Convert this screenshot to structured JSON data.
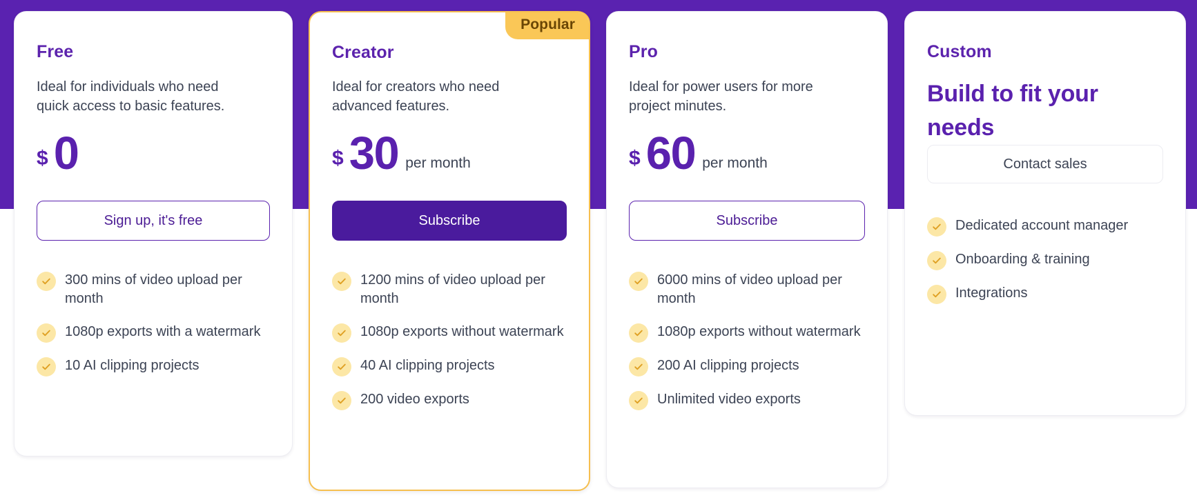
{
  "page": {
    "background_band_color": "#5a22b0",
    "page_background": "#ffffff"
  },
  "colors": {
    "brand_purple": "#5a21ae",
    "brand_purple_dark": "#4a1b9d",
    "accent_amber": "#fac757",
    "check_circle": "#fce7a6",
    "check_mark": "#dfa023",
    "body_text": "#3c4354"
  },
  "plans": [
    {
      "id": "free",
      "name": "Free",
      "description": "Ideal for individuals who need quick access to basic features.",
      "currency": "$",
      "amount": "0",
      "period": "",
      "cta_label": "Sign up, it's free",
      "cta_style": "outline-purple",
      "badge": null,
      "headline": null,
      "features": [
        "300 mins of video upload per month",
        "1080p exports with a watermark",
        "10 AI clipping projects"
      ]
    },
    {
      "id": "creator",
      "name": "Creator",
      "description": "Ideal for creators who need advanced features.",
      "currency": "$",
      "amount": "30",
      "period": "per month",
      "cta_label": "Subscribe",
      "cta_style": "solid-purple",
      "badge": "Popular",
      "headline": null,
      "features": [
        "1200 mins of video upload per month",
        "1080p exports without watermark",
        "40 AI clipping projects",
        "200 video exports"
      ]
    },
    {
      "id": "pro",
      "name": "Pro",
      "description": "Ideal for power users for more project minutes.",
      "currency": "$",
      "amount": "60",
      "period": "per month",
      "cta_label": "Subscribe",
      "cta_style": "outline-purple",
      "badge": null,
      "headline": null,
      "features": [
        "6000 mins of video upload per month",
        "1080p exports without watermark",
        "200 AI clipping projects",
        "Unlimited video exports"
      ]
    },
    {
      "id": "custom",
      "name": "Custom",
      "description": null,
      "currency": null,
      "amount": null,
      "period": null,
      "cta_label": "Contact sales",
      "cta_style": "outline-grey",
      "badge": null,
      "headline": "Build to fit your needs",
      "features": [
        "Dedicated account manager",
        "Onboarding & training",
        "Integrations"
      ]
    }
  ],
  "icons": {
    "check": "check-icon"
  }
}
